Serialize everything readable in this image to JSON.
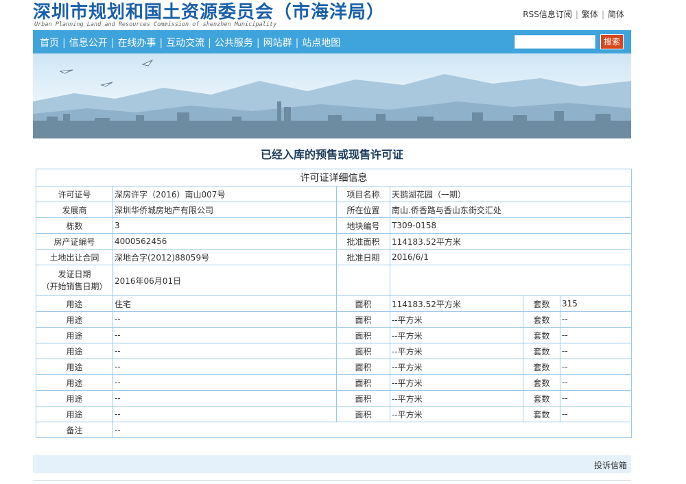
{
  "header": {
    "title": "深圳市规划和国土资源委员会（市海洋局）",
    "subtitle": "Urban Planning Land and Resources Commission of shenzhen Municipality",
    "links": [
      "RSS信息订阅",
      "繁体",
      "简体"
    ]
  },
  "nav": {
    "items": [
      "首页",
      "信息公开",
      "在线办事",
      "互动交流",
      "公共服务",
      "网站群",
      "站点地图"
    ],
    "search_button": "搜索",
    "search_value": ""
  },
  "page": {
    "heading": "已经入库的预售或现售许可证",
    "table_caption": "许可证详细信息"
  },
  "info": {
    "permit_no_label": "许可证号",
    "permit_no": "深房许字（2016）南山007号",
    "project_label": "项目名称",
    "project": "天鹅湖花园（一期）",
    "developer_label": "发展商",
    "developer": "深圳华侨城房地产有限公司",
    "location_label": "所在位置",
    "location": "南山.侨香路与香山东街交汇处",
    "buildings_label": "栋数",
    "buildings": "3",
    "parcel_label": "地块编号",
    "parcel": "T309-0158",
    "cert_label": "房产证编号",
    "cert": "4000562456",
    "approved_area_label": "批准面积",
    "approved_area": "114183.52平方米",
    "contract_label": "土地出让合同",
    "contract": "深地合字(2012)88059号",
    "approved_date_label": "批准日期",
    "approved_date": "2016/6/1",
    "issue_date_label_1": "发证日期",
    "issue_date_label_2": "（开始销售日期）",
    "issue_date": "2016年06月01日"
  },
  "usage_labels": {
    "use": "用途",
    "area": "面积",
    "units": "套数"
  },
  "usage_rows": [
    {
      "use": "住宅",
      "area": "114183.52平方米",
      "units": "315"
    },
    {
      "use": "--",
      "area": "--平方米",
      "units": "--"
    },
    {
      "use": "--",
      "area": "--平方米",
      "units": "--"
    },
    {
      "use": "--",
      "area": "--平方米",
      "units": "--"
    },
    {
      "use": "--",
      "area": "--平方米",
      "units": "--"
    },
    {
      "use": "--",
      "area": "--平方米",
      "units": "--"
    },
    {
      "use": "--",
      "area": "--平方米",
      "units": "--"
    },
    {
      "use": "--",
      "area": "--平方米",
      "units": "--"
    }
  ],
  "remarks": {
    "label": "备注",
    "value": "--"
  },
  "footer": {
    "complaint": "投诉信箱"
  },
  "colors": {
    "brand": "#1a5fa8",
    "nav": "#3fa3dc",
    "search": "#d9461c",
    "border": "#9cc9e8"
  }
}
